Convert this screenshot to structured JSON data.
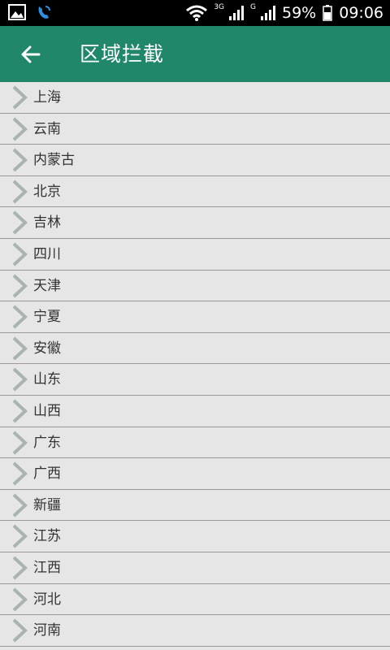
{
  "status_bar": {
    "network_3g": "3G",
    "network_g": "G",
    "battery": "59%",
    "time": "09:06"
  },
  "app_bar": {
    "title": "区域拦截"
  },
  "regions": [
    "上海",
    "云南",
    "内蒙古",
    "北京",
    "吉林",
    "四川",
    "天津",
    "宁夏",
    "安徽",
    "山东",
    "山西",
    "广东",
    "广西",
    "新疆",
    "江苏",
    "江西",
    "河北",
    "河南"
  ],
  "colors": {
    "accent": "#21876a",
    "list_bg": "#e6e6e6",
    "chevron": "#a9b3b0"
  }
}
